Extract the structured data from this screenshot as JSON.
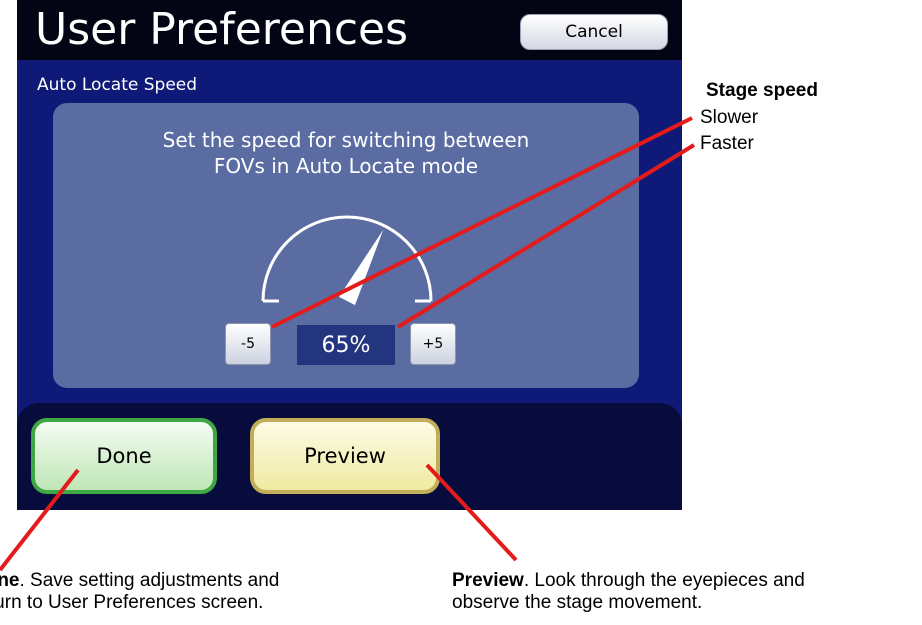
{
  "window": {
    "title": "User Preferences",
    "cancel_label": "Cancel",
    "section_title": "Auto Locate Speed"
  },
  "panel": {
    "prompt_line1": "Set the speed for switching between",
    "prompt_line2": "FOVs in Auto Locate mode",
    "speed_percent": 65,
    "value_label": "65%",
    "decrement_label": "-5",
    "increment_label": "+5"
  },
  "actions": {
    "done_label": "Done",
    "preview_label": "Preview"
  },
  "annotations": {
    "stage_heading": "Stage speed",
    "stage_slower": "Slower",
    "stage_faster": "Faster",
    "done_title": "Done",
    "done_text_line1": ". Save setting adjustments and",
    "done_text_line2": "return to User Preferences screen.",
    "preview_title": "Preview",
    "preview_text_line1": ". Look through the eyepieces and",
    "preview_text_line2": "observe the stage movement."
  },
  "colors": {
    "screen_bg": "#0f1a78",
    "title_bar": "#030414",
    "panel": "#5a6ca1",
    "done_border": "#3ea844",
    "preview_border": "#c2ad5b",
    "callout_line": "#e31b1b"
  }
}
